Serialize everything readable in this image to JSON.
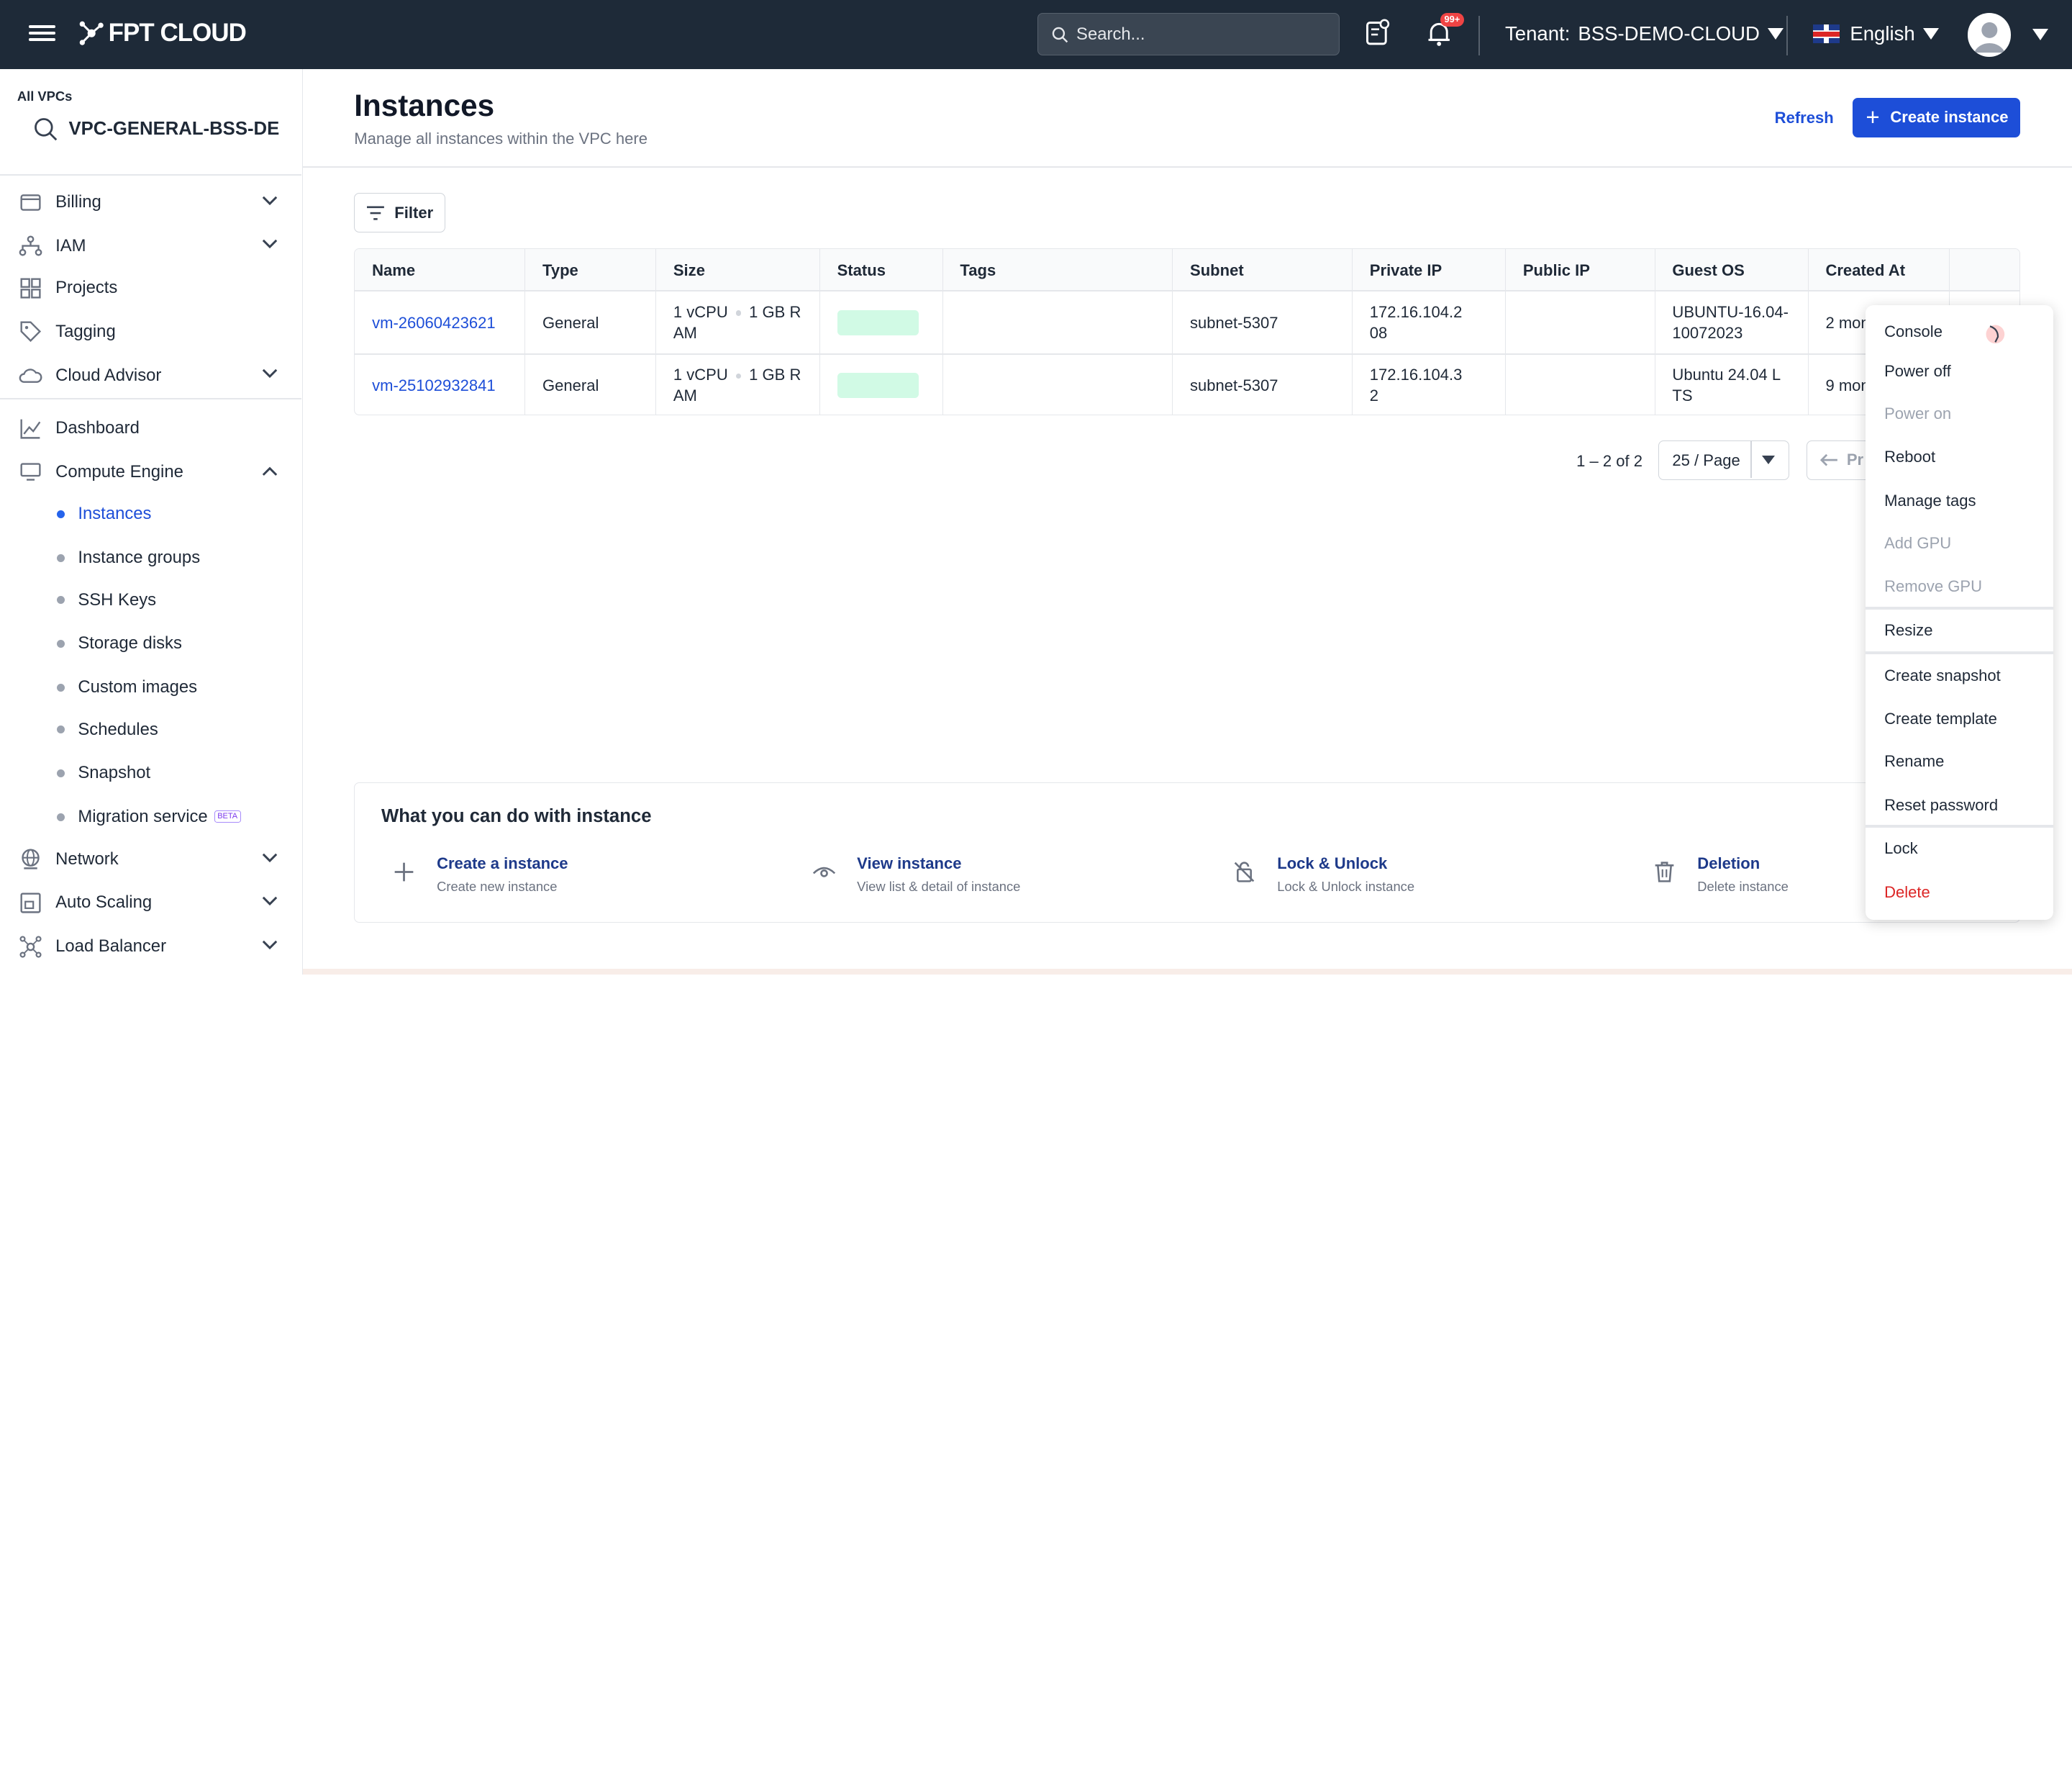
{
  "topbar": {
    "logo_text": "FPT CLOUD",
    "search_placeholder": "Search...",
    "notification_badge": "99+",
    "tenant_label": "Tenant:",
    "tenant_value": "BSS-DEMO-CLOUD",
    "language": "English"
  },
  "sidebar": {
    "all_vpcs_label": "All VPCs",
    "vpc_name": "VPC-GENERAL-BSS-DE",
    "items": {
      "billing": "Billing",
      "iam": "IAM",
      "projects": "Projects",
      "tagging": "Tagging",
      "cloud_advisor": "Cloud Advisor",
      "dashboard": "Dashboard",
      "compute_engine": "Compute Engine",
      "network": "Network",
      "auto_scaling": "Auto Scaling",
      "load_balancer": "Load Balancer"
    },
    "compute_sub": {
      "instances": "Instances",
      "instance_groups": "Instance groups",
      "ssh_keys": "SSH Keys",
      "storage_disks": "Storage disks",
      "custom_images": "Custom images",
      "schedules": "Schedules",
      "snapshot": "Snapshot",
      "migration_service": "Migration service",
      "beta_badge": "BETA"
    }
  },
  "page": {
    "title": "Instances",
    "subtitle": "Manage all instances within the VPC here",
    "refresh_label": "Refresh",
    "create_label": "Create instance",
    "filter_label": "Filter"
  },
  "table": {
    "columns": {
      "name": "Name",
      "type": "Type",
      "size": "Size",
      "status": "Status",
      "tags": "Tags",
      "subnet": "Subnet",
      "private_ip": "Private IP",
      "public_ip": "Public IP",
      "guest_os": "Guest OS",
      "created_at": "Created At"
    },
    "rows": [
      {
        "name": "vm-26060423621",
        "type": "General",
        "cpu": "1 vCPU",
        "ram_line1": "1 GB R",
        "ram_line2": "AM",
        "subnet": "subnet-5307",
        "ip_line1": "172.16.104.2",
        "ip_line2": "08",
        "os_line1": "UBUNTU-16.04-",
        "os_line2": "10072023",
        "created": "2 mon"
      },
      {
        "name": "vm-25102932841",
        "type": "General",
        "cpu": "1 vCPU",
        "ram_line1": "1 GB R",
        "ram_line2": "AM",
        "subnet": "subnet-5307",
        "ip_line1": "172.16.104.3",
        "ip_line2": "2",
        "os_line1": "Ubuntu 24.04 L",
        "os_line2": "TS",
        "created": "9 mon"
      }
    ]
  },
  "pagination": {
    "range": "1 – 2 of 2",
    "page_size": "25 / Page",
    "prev_label": "Pr"
  },
  "actions_section": {
    "title": "What you can do with instance",
    "items": [
      {
        "title": "Create a instance",
        "desc": "Create new instance"
      },
      {
        "title": "View instance",
        "desc": "View list & detail of instance"
      },
      {
        "title": "Lock & Unlock",
        "desc": "Lock & Unlock instance"
      },
      {
        "title": "Deletion",
        "desc": "Delete instance"
      }
    ]
  },
  "context_menu": {
    "console": "Console",
    "power_off": "Power off",
    "power_on": "Power on",
    "reboot": "Reboot",
    "manage_tags": "Manage tags",
    "add_gpu": "Add GPU",
    "remove_gpu": "Remove GPU",
    "resize": "Resize",
    "create_snapshot": "Create snapshot",
    "create_template": "Create template",
    "rename": "Rename",
    "reset_password": "Reset password",
    "lock": "Lock",
    "delete": "Delete"
  },
  "colors": {
    "topbar_bg": "#1e2a38",
    "primary": "#1d4ed8",
    "status_running": "#d1fae5",
    "danger": "#dc2626"
  }
}
